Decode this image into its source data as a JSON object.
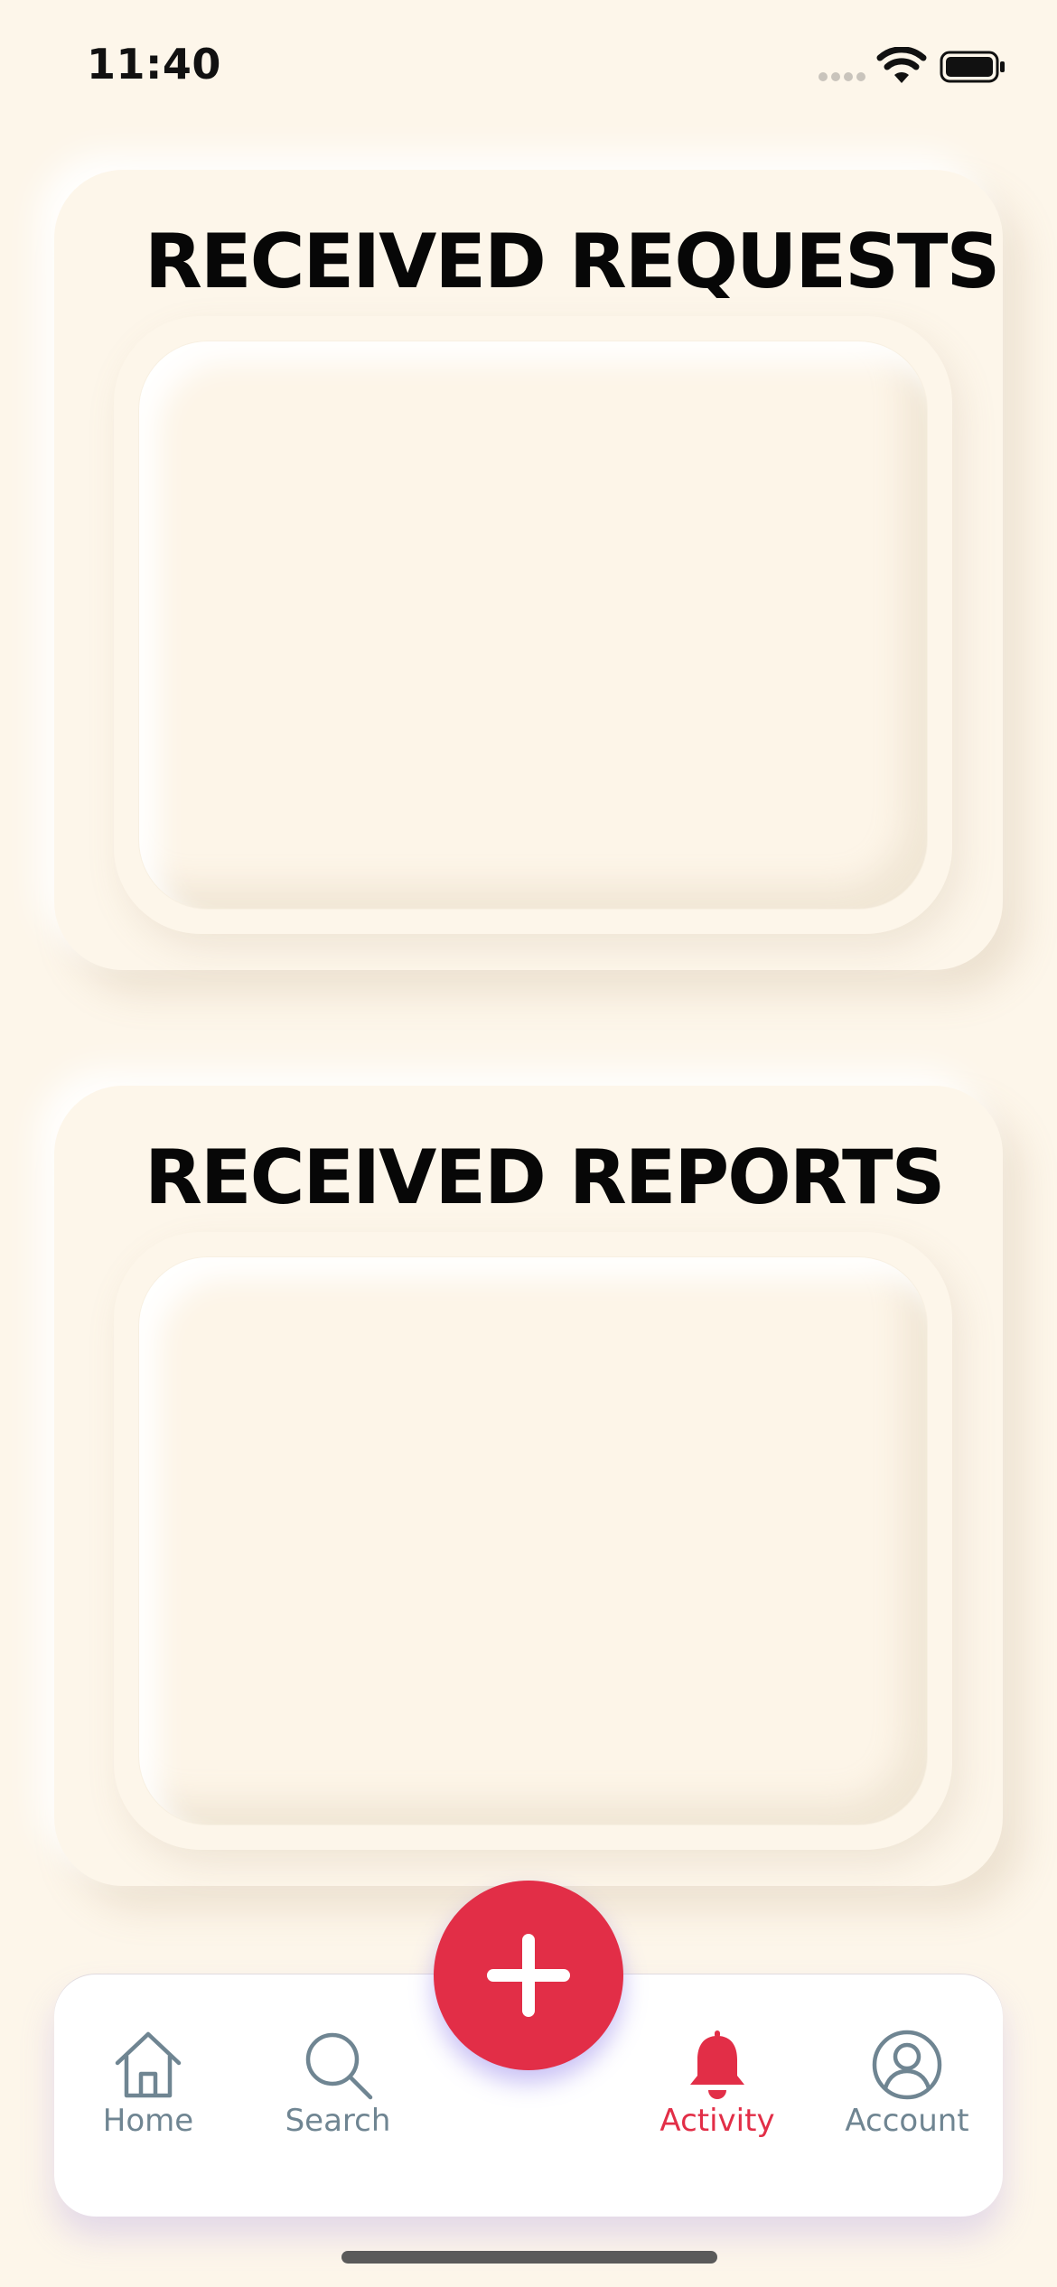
{
  "status_bar": {
    "time": "11:40",
    "icons": [
      "signal-dots-icon",
      "wifi-icon",
      "battery-icon"
    ]
  },
  "sections": {
    "requests": {
      "title": "RECEIVED REQUESTS"
    },
    "reports": {
      "title": "RECEIVED REPORTS"
    }
  },
  "tab_bar": {
    "fab": {
      "icon": "plus-icon"
    },
    "items": [
      {
        "label": "Home",
        "icon": "home-icon",
        "active": false
      },
      {
        "label": "Search",
        "icon": "search-icon",
        "active": false
      },
      {
        "label": "Activity",
        "icon": "bell-icon",
        "active": true
      },
      {
        "label": "Account",
        "icon": "account-icon",
        "active": false
      }
    ]
  },
  "colors": {
    "background": "#fdf6ea",
    "accent": "#e22e47",
    "tab_inactive": "#6f8592",
    "title": "#070707"
  }
}
